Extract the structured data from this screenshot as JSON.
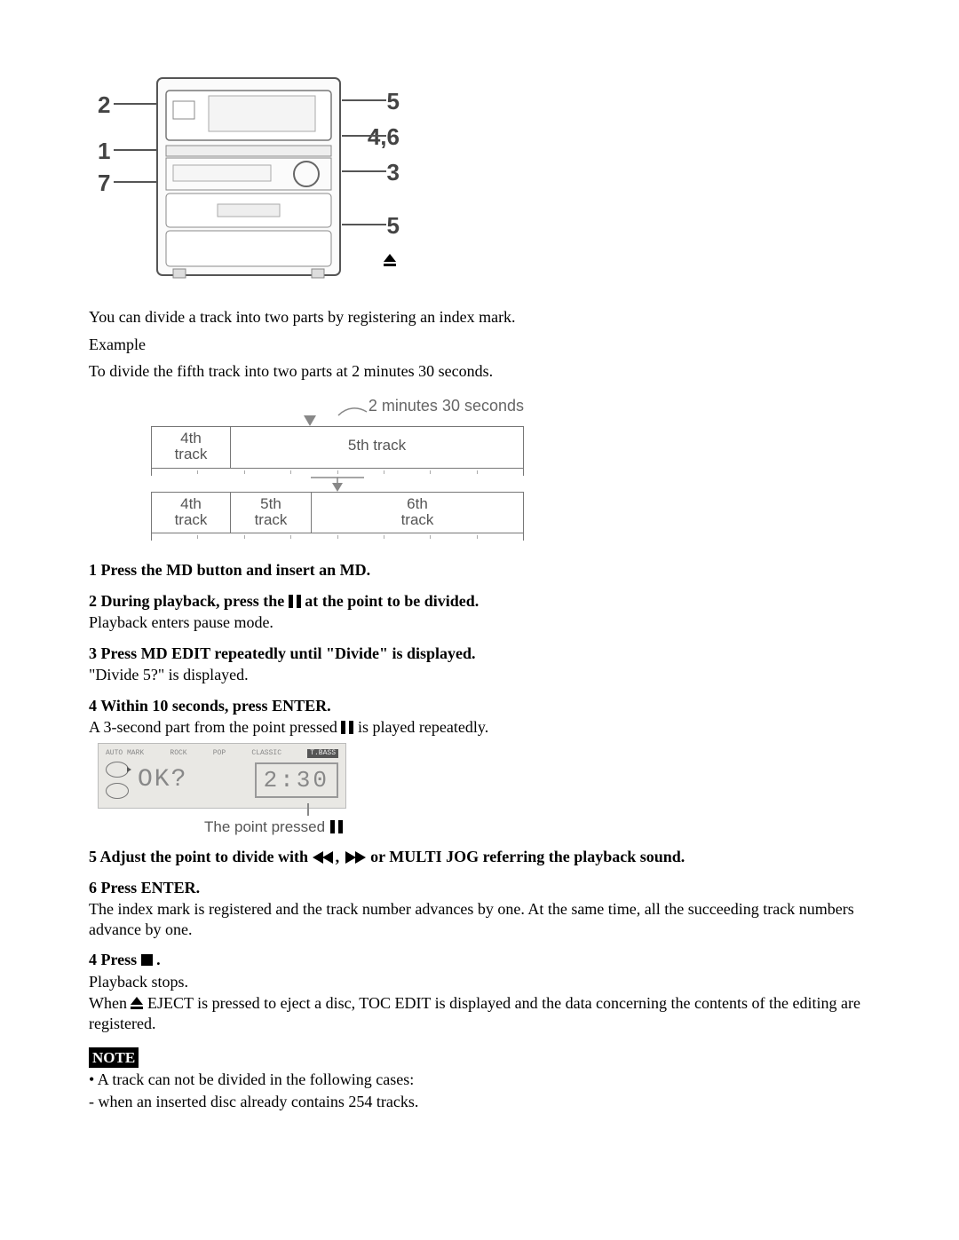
{
  "diagram": {
    "labels_left": [
      "2",
      "1",
      "7"
    ],
    "labels_right": [
      "5",
      "4,6",
      "3",
      "5"
    ]
  },
  "intro": {
    "line1": "You can divide a track into two parts by registering an index mark.",
    "line2": "Example",
    "line3": "To divide the fifth track into two parts at 2 minutes 30 seconds."
  },
  "track_diagram": {
    "caption": "2 minutes 30 seconds",
    "before": {
      "c1": "4th\ntrack",
      "c2": "5th track"
    },
    "after": {
      "c1": "4th\ntrack",
      "c2": "5th\ntrack",
      "c3": "6th\ntrack"
    }
  },
  "steps": {
    "s1": {
      "num": "1",
      "head": "Press the MD button and insert an MD."
    },
    "s2": {
      "num": "2",
      "head_a": "During playback, press the ",
      "head_b": " at the point to be divided.",
      "body": "Playback enters pause mode."
    },
    "s3": {
      "num": "3",
      "head": "Press MD EDIT repeatedly until \"Divide\" is displayed.",
      "body": "\"Divide 5?\" is displayed."
    },
    "s4": {
      "num": "4",
      "head": "Within 10 seconds, press ENTER.",
      "body_a": "A 3-second part from the point pressed ",
      "body_b": " is played repeatedly."
    },
    "display": {
      "ok": "OK?",
      "time": "2:30",
      "caption": "The point pressed "
    },
    "s5": {
      "num": "5",
      "head_a": "Adjust the point to divide with ",
      "comma": ", ",
      "head_b": " or MULTI JOG referring the playback sound."
    },
    "s6": {
      "num": "6",
      "head": "Press ENTER.",
      "body": "The index mark is registered and the track number advances by one.  At the same time, all the succeeding track numbers advance by one."
    },
    "s7": {
      "num": "4",
      "head_a": "Press ",
      "period": " .",
      "body1": "Playback stops.",
      "body2_a": "When ",
      "body2_b": " EJECT is pressed to eject a disc, TOC EDIT is displayed and the data concerning the contents of the editing are registered."
    }
  },
  "note": {
    "label": "NOTE",
    "l1": "• A track can not be divided in the following cases:",
    "l2": "- when an inserted disc already contains 254 tracks."
  }
}
